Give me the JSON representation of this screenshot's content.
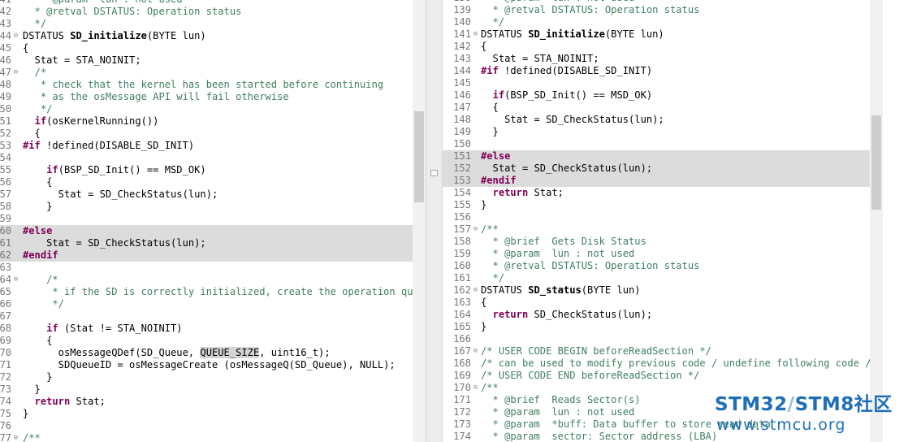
{
  "colors": {
    "keyword": "#7f0055",
    "comment": "#3f7f5f",
    "line_number": "#787878",
    "highlight_bg": "#dcdcdc",
    "watermark_blue": "#1e6fb8",
    "watermark_light": "#8cbce2"
  },
  "icons": {
    "fold_collapse": "minus-circle-icon"
  },
  "left_editor": {
    "lines": [
      {
        "num": "41",
        "fold": false,
        "hl": false,
        "tokens": [
          {
            "t": "   * @param  lun : not used",
            "c": "cm"
          }
        ]
      },
      {
        "num": "42",
        "fold": false,
        "hl": false,
        "tokens": [
          {
            "t": "  * @retval DSTATUS: Operation status",
            "c": "cm"
          }
        ]
      },
      {
        "num": "43",
        "fold": false,
        "hl": false,
        "tokens": [
          {
            "t": "  */",
            "c": "cm"
          }
        ]
      },
      {
        "num": "44",
        "fold": true,
        "hl": false,
        "tokens": [
          {
            "t": "DSTATUS ",
            "c": "plain"
          },
          {
            "t": "SD_initialize",
            "c": "fn"
          },
          {
            "t": "(BYTE lun)",
            "c": "plain"
          }
        ]
      },
      {
        "num": "45",
        "fold": false,
        "hl": false,
        "tokens": [
          {
            "t": "{",
            "c": "plain"
          }
        ]
      },
      {
        "num": "46",
        "fold": false,
        "hl": false,
        "tokens": [
          {
            "t": "  Stat = STA_NOINIT;",
            "c": "plain"
          }
        ]
      },
      {
        "num": "47",
        "fold": true,
        "hl": false,
        "tokens": [
          {
            "t": "  /*",
            "c": "cm"
          }
        ]
      },
      {
        "num": "48",
        "fold": false,
        "hl": false,
        "tokens": [
          {
            "t": "   * check that the kernel has been started before continuing",
            "c": "cm"
          }
        ]
      },
      {
        "num": "49",
        "fold": false,
        "hl": false,
        "tokens": [
          {
            "t": "   * as the osMessage API will fail otherwise",
            "c": "cm"
          }
        ]
      },
      {
        "num": "50",
        "fold": false,
        "hl": false,
        "tokens": [
          {
            "t": "   */",
            "c": "cm"
          }
        ]
      },
      {
        "num": "51",
        "fold": false,
        "hl": false,
        "tokens": [
          {
            "t": "  ",
            "c": "plain"
          },
          {
            "t": "if",
            "c": "kw"
          },
          {
            "t": "(osKernelRunning())",
            "c": "plain"
          }
        ]
      },
      {
        "num": "52",
        "fold": false,
        "hl": false,
        "tokens": [
          {
            "t": "  {",
            "c": "plain"
          }
        ]
      },
      {
        "num": "53",
        "fold": false,
        "hl": false,
        "tokens": [
          {
            "t": "#if",
            "c": "pp"
          },
          {
            "t": " !defined(DISABLE_SD_INIT)",
            "c": "plain"
          }
        ]
      },
      {
        "num": "54",
        "fold": false,
        "hl": false,
        "tokens": []
      },
      {
        "num": "55",
        "fold": false,
        "hl": false,
        "tokens": [
          {
            "t": "    ",
            "c": "plain"
          },
          {
            "t": "if",
            "c": "kw"
          },
          {
            "t": "(BSP_SD_Init() == MSD_OK)",
            "c": "plain"
          }
        ]
      },
      {
        "num": "56",
        "fold": false,
        "hl": false,
        "tokens": [
          {
            "t": "    {",
            "c": "plain"
          }
        ]
      },
      {
        "num": "57",
        "fold": false,
        "hl": false,
        "tokens": [
          {
            "t": "      Stat = SD_CheckStatus(lun);",
            "c": "plain"
          }
        ]
      },
      {
        "num": "58",
        "fold": false,
        "hl": false,
        "tokens": [
          {
            "t": "    }",
            "c": "plain"
          }
        ]
      },
      {
        "num": "59",
        "fold": false,
        "hl": false,
        "tokens": []
      },
      {
        "num": "60",
        "fold": false,
        "hl": true,
        "tokens": [
          {
            "t": "#else",
            "c": "pp"
          }
        ]
      },
      {
        "num": "61",
        "fold": false,
        "hl": true,
        "tokens": [
          {
            "t": "    Stat = SD_CheckStatus(lun);",
            "c": "plain"
          }
        ]
      },
      {
        "num": "62",
        "fold": false,
        "hl": true,
        "tokens": [
          {
            "t": "#endif",
            "c": "pp"
          }
        ]
      },
      {
        "num": "63",
        "fold": false,
        "hl": false,
        "tokens": []
      },
      {
        "num": "64",
        "fold": true,
        "hl": false,
        "tokens": [
          {
            "t": "    /*",
            "c": "cm"
          }
        ]
      },
      {
        "num": "65",
        "fold": false,
        "hl": false,
        "tokens": [
          {
            "t": "     * if the SD is correctly initialized, create the operation queue",
            "c": "cm"
          }
        ]
      },
      {
        "num": "66",
        "fold": false,
        "hl": false,
        "tokens": [
          {
            "t": "     */",
            "c": "cm"
          }
        ]
      },
      {
        "num": "67",
        "fold": false,
        "hl": false,
        "tokens": []
      },
      {
        "num": "68",
        "fold": false,
        "hl": false,
        "tokens": [
          {
            "t": "    ",
            "c": "plain"
          },
          {
            "t": "if",
            "c": "kw"
          },
          {
            "t": " (Stat != STA_NOINIT)",
            "c": "plain"
          }
        ]
      },
      {
        "num": "69",
        "fold": false,
        "hl": false,
        "tokens": [
          {
            "t": "    {",
            "c": "plain"
          }
        ]
      },
      {
        "num": "70",
        "fold": false,
        "hl": false,
        "tokens": [
          {
            "t": "      osMessageQDef(SD_Queue, ",
            "c": "plain"
          },
          {
            "t": "QUEUE_SIZE",
            "c": "mark"
          },
          {
            "t": ", uint16_t);",
            "c": "plain"
          }
        ]
      },
      {
        "num": "71",
        "fold": false,
        "hl": false,
        "tokens": [
          {
            "t": "      SDQueueID = osMessageCreate (osMessageQ(SD_Queue), NULL);",
            "c": "plain"
          }
        ]
      },
      {
        "num": "72",
        "fold": false,
        "hl": false,
        "tokens": [
          {
            "t": "    }",
            "c": "plain"
          }
        ]
      },
      {
        "num": "73",
        "fold": false,
        "hl": false,
        "tokens": [
          {
            "t": "  }",
            "c": "plain"
          }
        ]
      },
      {
        "num": "74",
        "fold": false,
        "hl": false,
        "tokens": [
          {
            "t": "  ",
            "c": "plain"
          },
          {
            "t": "return",
            "c": "kw"
          },
          {
            "t": " Stat;",
            "c": "plain"
          }
        ]
      },
      {
        "num": "75",
        "fold": false,
        "hl": false,
        "tokens": [
          {
            "t": "}",
            "c": "plain"
          }
        ]
      },
      {
        "num": "76",
        "fold": false,
        "hl": false,
        "tokens": []
      },
      {
        "num": "77",
        "fold": true,
        "hl": false,
        "tokens": [
          {
            "t": "/**",
            "c": "cm"
          }
        ]
      }
    ]
  },
  "right_editor": {
    "lines": [
      {
        "num": "138",
        "fold": false,
        "hl": false,
        "tokens": [
          {
            "t": "  * @param  lun : not used",
            "c": "cm"
          }
        ]
      },
      {
        "num": "139",
        "fold": false,
        "hl": false,
        "tokens": [
          {
            "t": "  * @retval DSTATUS: Operation status",
            "c": "cm"
          }
        ]
      },
      {
        "num": "140",
        "fold": false,
        "hl": false,
        "tokens": [
          {
            "t": "  */",
            "c": "cm"
          }
        ]
      },
      {
        "num": "141",
        "fold": true,
        "hl": false,
        "tokens": [
          {
            "t": "DSTATUS ",
            "c": "plain"
          },
          {
            "t": "SD_initialize",
            "c": "fn"
          },
          {
            "t": "(BYTE lun)",
            "c": "plain"
          }
        ]
      },
      {
        "num": "142",
        "fold": false,
        "hl": false,
        "tokens": [
          {
            "t": "{",
            "c": "plain"
          }
        ]
      },
      {
        "num": "143",
        "fold": false,
        "hl": false,
        "tokens": [
          {
            "t": "  Stat = STA_NOINIT;",
            "c": "plain"
          }
        ]
      },
      {
        "num": "144",
        "fold": false,
        "hl": false,
        "tokens": [
          {
            "t": "#if",
            "c": "pp"
          },
          {
            "t": " !defined(DISABLE_SD_INIT)",
            "c": "plain"
          }
        ]
      },
      {
        "num": "145",
        "fold": false,
        "hl": false,
        "tokens": []
      },
      {
        "num": "146",
        "fold": false,
        "hl": false,
        "tokens": [
          {
            "t": "  ",
            "c": "plain"
          },
          {
            "t": "if",
            "c": "kw"
          },
          {
            "t": "(BSP_SD_Init() == MSD_OK)",
            "c": "plain"
          }
        ]
      },
      {
        "num": "147",
        "fold": false,
        "hl": false,
        "tokens": [
          {
            "t": "  {",
            "c": "plain"
          }
        ]
      },
      {
        "num": "148",
        "fold": false,
        "hl": false,
        "tokens": [
          {
            "t": "    Stat = SD_CheckStatus(lun);",
            "c": "plain"
          }
        ]
      },
      {
        "num": "149",
        "fold": false,
        "hl": false,
        "tokens": [
          {
            "t": "  }",
            "c": "plain"
          }
        ]
      },
      {
        "num": "150",
        "fold": false,
        "hl": false,
        "tokens": []
      },
      {
        "num": "151",
        "fold": false,
        "hl": true,
        "tokens": [
          {
            "t": "#else",
            "c": "pp"
          }
        ]
      },
      {
        "num": "152",
        "fold": false,
        "hl": true,
        "tokens": [
          {
            "t": "  Stat = SD_CheckStatus(lun);",
            "c": "plain"
          }
        ]
      },
      {
        "num": "153",
        "fold": false,
        "hl": true,
        "tokens": [
          {
            "t": "#endif",
            "c": "pp"
          }
        ]
      },
      {
        "num": "154",
        "fold": false,
        "hl": false,
        "tokens": [
          {
            "t": "  ",
            "c": "plain"
          },
          {
            "t": "return",
            "c": "kw"
          },
          {
            "t": " Stat;",
            "c": "plain"
          }
        ]
      },
      {
        "num": "155",
        "fold": false,
        "hl": false,
        "tokens": [
          {
            "t": "}",
            "c": "plain"
          }
        ]
      },
      {
        "num": "156",
        "fold": false,
        "hl": false,
        "tokens": []
      },
      {
        "num": "157",
        "fold": true,
        "hl": false,
        "tokens": [
          {
            "t": "/**",
            "c": "cm"
          }
        ]
      },
      {
        "num": "158",
        "fold": false,
        "hl": false,
        "tokens": [
          {
            "t": "  * @brief  Gets Disk Status",
            "c": "cm"
          }
        ]
      },
      {
        "num": "159",
        "fold": false,
        "hl": false,
        "tokens": [
          {
            "t": "  * @param  lun : not used",
            "c": "cm"
          }
        ]
      },
      {
        "num": "160",
        "fold": false,
        "hl": false,
        "tokens": [
          {
            "t": "  * @retval DSTATUS: Operation status",
            "c": "cm"
          }
        ]
      },
      {
        "num": "161",
        "fold": false,
        "hl": false,
        "tokens": [
          {
            "t": "  */",
            "c": "cm"
          }
        ]
      },
      {
        "num": "162",
        "fold": true,
        "hl": false,
        "tokens": [
          {
            "t": "DSTATUS ",
            "c": "plain"
          },
          {
            "t": "SD_status",
            "c": "fn"
          },
          {
            "t": "(BYTE lun)",
            "c": "plain"
          }
        ]
      },
      {
        "num": "163",
        "fold": false,
        "hl": false,
        "tokens": [
          {
            "t": "{",
            "c": "plain"
          }
        ]
      },
      {
        "num": "164",
        "fold": false,
        "hl": false,
        "tokens": [
          {
            "t": "  ",
            "c": "plain"
          },
          {
            "t": "return",
            "c": "kw"
          },
          {
            "t": " SD_CheckStatus(lun);",
            "c": "plain"
          }
        ]
      },
      {
        "num": "165",
        "fold": false,
        "hl": false,
        "tokens": [
          {
            "t": "}",
            "c": "plain"
          }
        ]
      },
      {
        "num": "166",
        "fold": false,
        "hl": false,
        "tokens": []
      },
      {
        "num": "167",
        "fold": true,
        "hl": false,
        "tokens": [
          {
            "t": "/* USER CODE BEGIN beforeReadSection */",
            "c": "cm"
          }
        ]
      },
      {
        "num": "168",
        "fold": false,
        "hl": false,
        "tokens": [
          {
            "t": "/* can be used to modify previous code / undefine following code / add",
            "c": "cm"
          }
        ]
      },
      {
        "num": "169",
        "fold": false,
        "hl": false,
        "tokens": [
          {
            "t": "/* USER CODE END beforeReadSection */",
            "c": "cm"
          }
        ]
      },
      {
        "num": "170",
        "fold": true,
        "hl": false,
        "tokens": [
          {
            "t": "/**",
            "c": "cm"
          }
        ]
      },
      {
        "num": "171",
        "fold": false,
        "hl": false,
        "tokens": [
          {
            "t": "  * @brief  Reads Sector(s)",
            "c": "cm"
          }
        ]
      },
      {
        "num": "172",
        "fold": false,
        "hl": false,
        "tokens": [
          {
            "t": "  * @param  lun : not used",
            "c": "cm"
          }
        ]
      },
      {
        "num": "173",
        "fold": false,
        "hl": false,
        "tokens": [
          {
            "t": "  * @param  *buff: Data buffer to store read data",
            "c": "cm"
          }
        ]
      },
      {
        "num": "174",
        "fold": false,
        "hl": false,
        "tokens": [
          {
            "t": "  * @param  sector: Sector address (LBA)",
            "c": "cm"
          }
        ]
      }
    ]
  },
  "watermark": {
    "brand_a": "STM32",
    "brand_slash": "/",
    "brand_b": "STM8",
    "brand_c": "社区",
    "url": "www.stmcu.org"
  }
}
